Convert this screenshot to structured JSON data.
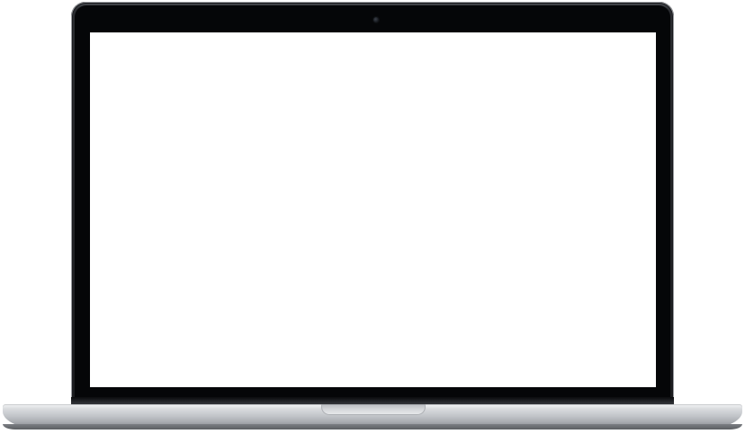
{
  "device": {
    "type": "laptop-mockup",
    "screen": {
      "content": ""
    },
    "colors": {
      "bezel": "#050608",
      "screen": "#ffffff",
      "chassis": "#c3c6ca"
    }
  }
}
